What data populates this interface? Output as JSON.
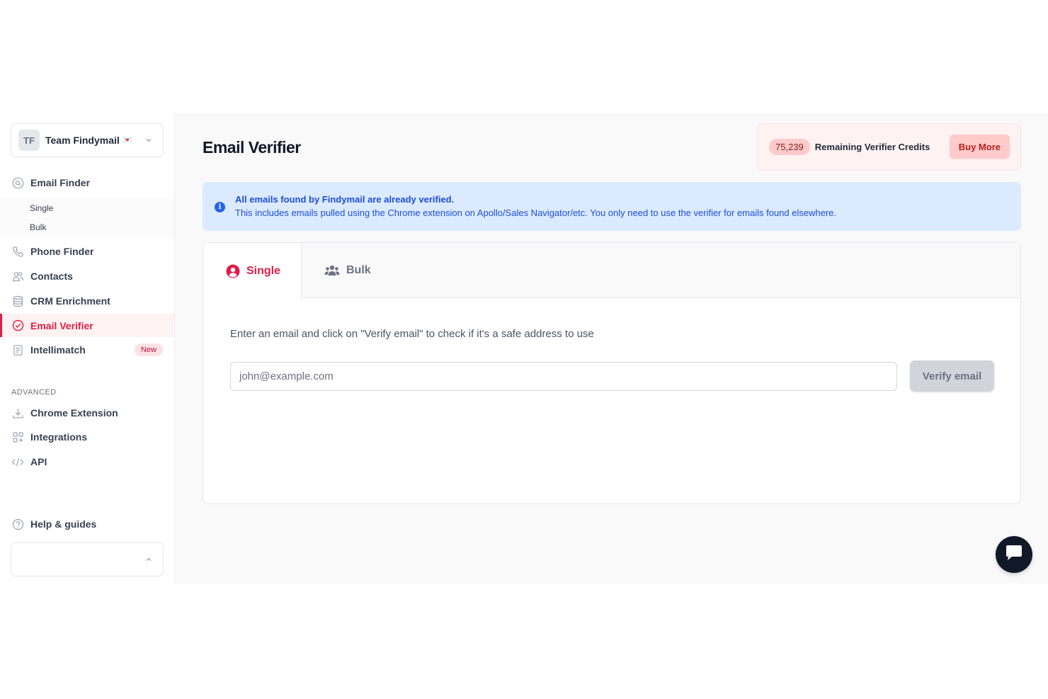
{
  "team": {
    "initials": "TF",
    "name": "Team Findymail",
    "emoji": "💌"
  },
  "nav": {
    "email_finder": "Email Finder",
    "email_finder_sub": [
      "Single",
      "Bulk"
    ],
    "phone_finder": "Phone Finder",
    "contacts": "Contacts",
    "crm_enrichment": "CRM Enrichment",
    "email_verifier": "Email Verifier",
    "intellimatch": "Intellimatch",
    "intellimatch_badge": "New",
    "advanced_label": "ADVANCED",
    "chrome_extension": "Chrome Extension",
    "integrations": "Integrations",
    "api": "API",
    "help": "Help & guides"
  },
  "page": {
    "title": "Email Verifier"
  },
  "credits": {
    "count": "75,239",
    "label": "Remaining Verifier Credits",
    "buy_label": "Buy More"
  },
  "info": {
    "title": "All emails found by Findymail are already verified.",
    "text": "This includes emails pulled using the Chrome extension on Apollo/Sales Navigator/etc. You only need to use the verifier for emails found elsewhere."
  },
  "tabs": {
    "single": "Single",
    "bulk": "Bulk"
  },
  "form": {
    "instructions": "Enter an email and click on \"Verify email\" to check if it's a safe address to use",
    "placeholder": "john@example.com",
    "button_label": "Verify email"
  },
  "colors": {
    "accent": "#e11d48",
    "info_bg": "#dbeafe",
    "info_text": "#1d4ed8"
  }
}
